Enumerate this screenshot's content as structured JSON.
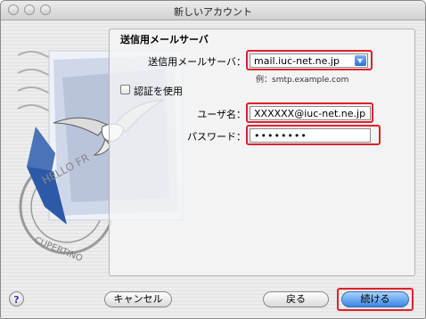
{
  "window": {
    "title": "新しいアカウント"
  },
  "section": {
    "title": "送信用メールサーバ"
  },
  "form": {
    "smtp_label": "送信用メールサーバ：",
    "smtp_value": "mail.iuc-net.ne.jp",
    "smtp_example": "例：smtp.example.com",
    "auth_label": "認証を使用",
    "auth_checked": false,
    "username_label": "ユーザ名：",
    "username_value": "XXXXXX@iuc-net.ne.jp",
    "password_label": "パスワード：",
    "password_value": "••••••••"
  },
  "artwork": {
    "text_top": "HELLO FR",
    "text_bottom": "CUPERTINO"
  },
  "buttons": {
    "help": "?",
    "cancel": "キャンセル",
    "back": "戻る",
    "continue": "続ける"
  },
  "colors": {
    "highlight": "#e0202a",
    "accent": "#3b86e0"
  }
}
